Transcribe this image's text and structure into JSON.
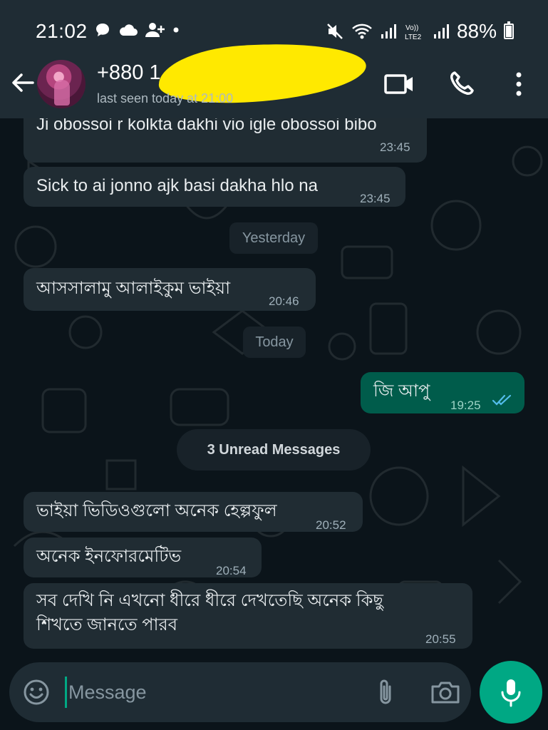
{
  "status_bar": {
    "time": "21:02",
    "battery_percent": "88%",
    "battery_level": 0.88,
    "left_icons": [
      "chat-bubble-icon",
      "cloud-icon",
      "person-add-icon",
      "dot-icon"
    ],
    "right_icons": [
      "mute-vibrate-icon",
      "wifi-icon",
      "signal-icon",
      "volte-lte2-icon",
      "signal-icon",
      "battery-charging-icon"
    ]
  },
  "header": {
    "contact_name": "+880 1",
    "last_seen": "last seen today at 21:00",
    "icons": [
      "back-arrow-icon",
      "video-call-icon",
      "phone-call-icon",
      "more-vert-icon"
    ]
  },
  "messages": [
    {
      "direction": "in",
      "text": "Ji obossoi r kolkta dakhi vio igle obossoi bibo",
      "time": "23:45"
    },
    {
      "direction": "in",
      "text": "Sick to ai jonno ajk basi dakha hlo na",
      "time": "23:45"
    },
    {
      "direction": "in",
      "text": "আসসালামু আলাইকুম ভাইয়া",
      "time": "20:46"
    },
    {
      "direction": "out",
      "text": "জি আপু",
      "time": "19:25",
      "status": "read"
    },
    {
      "direction": "in",
      "text": "ভাইয়া ভিডিওগুলো অনেক হেল্পফুল",
      "time": "20:52"
    },
    {
      "direction": "in",
      "text": "অনেক ইনফোরমেটিভ",
      "time": "20:54"
    },
    {
      "direction": "in",
      "text_lines": [
        "সব দেখি নি এখনো ধীরে ধীরে দেখতেছি অনেক কিছু",
        "শিখতে জানতে পারব"
      ],
      "time": "20:55"
    }
  ],
  "date_chips": {
    "yesterday": "Yesterday",
    "today": "Today"
  },
  "unread_banner": "3 Unread Messages",
  "composer": {
    "placeholder": "Message",
    "icons": [
      "emoji-icon",
      "paperclip-icon",
      "camera-icon",
      "microphone-icon"
    ]
  },
  "colors": {
    "header_bg": "#1f2c34",
    "chat_bg": "#0b141a",
    "incoming_bubble": "#202c33",
    "outgoing_bubble": "#005c4b",
    "accent": "#00a884",
    "read_ticks": "#53bdeb",
    "redaction": "#ffe900"
  }
}
